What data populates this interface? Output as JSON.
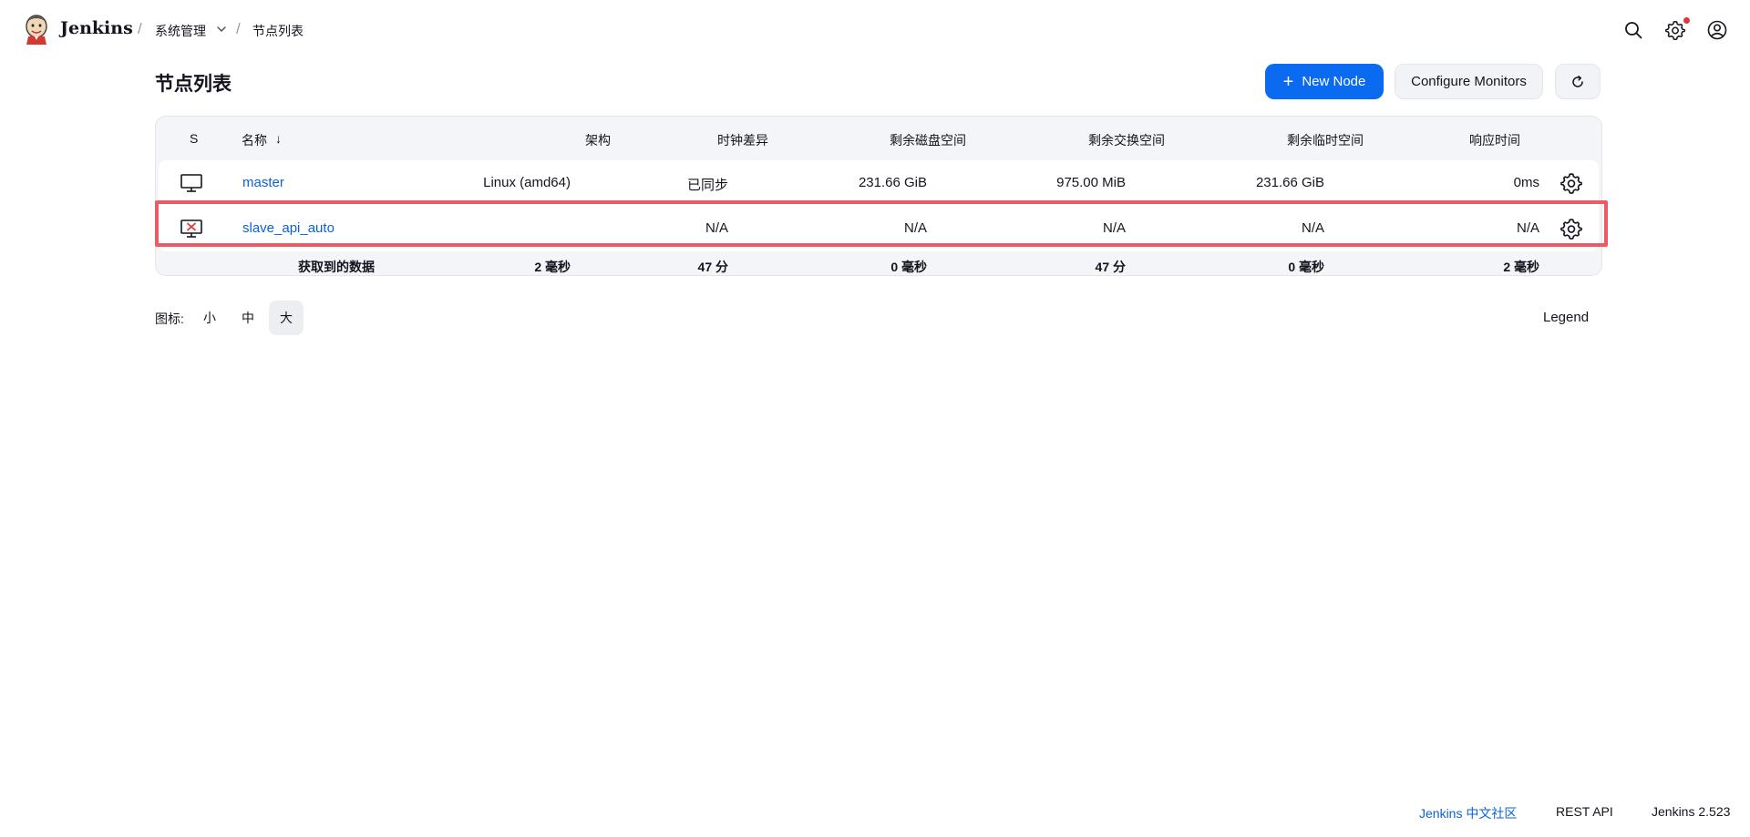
{
  "header": {
    "brand": "Jenkins",
    "breadcrumbs": [
      "系统管理",
      "节点列表"
    ],
    "icons": [
      "search-icon",
      "settings-icon",
      "user-icon"
    ],
    "notification_color": "#e5343a"
  },
  "page": {
    "title": "节点列表",
    "new_node_label": "New Node",
    "configure_monitors_label": "Configure Monitors"
  },
  "table": {
    "headers": {
      "status": "S",
      "name": "名称",
      "sort_indicator": "↓",
      "arch": "架构",
      "clock": "时钟差异",
      "disk": "剩余磁盘空间",
      "swap": "剩余交换空间",
      "temp": "剩余临时空间",
      "response": "响应时间"
    },
    "rows": [
      {
        "name": "master",
        "status_icon": "computer-icon",
        "arch": "Linux (amd64)",
        "clock": "已同步",
        "disk": "231.66 GiB",
        "swap": "975.00 MiB",
        "temp": "231.66 GiB",
        "response": "0ms"
      },
      {
        "name": "slave_api_auto",
        "status_icon": "computer-offline-icon",
        "arch": "",
        "clock": "N/A",
        "disk": "N/A",
        "swap": "N/A",
        "temp": "N/A",
        "response": "N/A"
      }
    ],
    "footer": {
      "label": "获取到的数据",
      "arch": "2 毫秒",
      "clock": "47 分",
      "disk": "0 毫秒",
      "swap": "47 分",
      "temp": "0 毫秒",
      "response": "2 毫秒"
    }
  },
  "icon_size": {
    "label": "图标:",
    "options": [
      "小",
      "中",
      "大"
    ],
    "selected": "大"
  },
  "legend_label": "Legend",
  "footer": {
    "community": "Jenkins 中文社区",
    "rest_api": "REST API",
    "version": "Jenkins 2.523"
  },
  "colors": {
    "primary": "#0b6bf0",
    "link": "#0b62d6",
    "highlight": "#ee5a63",
    "offline": "#e5343a"
  }
}
